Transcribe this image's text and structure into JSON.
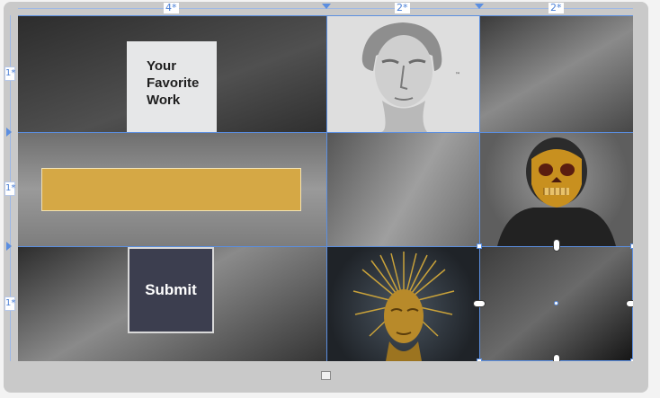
{
  "columns": {
    "col1_label": "4*",
    "col2_label": "2*",
    "col3_label": "2*"
  },
  "rows": {
    "row1_label": "1*",
    "row2_label": "1*",
    "row3_label": "1*"
  },
  "title_card": {
    "text": "Your\nFavorite\nWork"
  },
  "submit_button": {
    "label": "Submit"
  },
  "colors": {
    "gridline": "#5b8ee0",
    "input_fill": "#d5a845",
    "button_fill": "#3c3e4f"
  },
  "icons": [
    "david-bust-image",
    "gold-skull-bust-image",
    "gold-crown-head-image",
    "grid-layout-icon"
  ]
}
